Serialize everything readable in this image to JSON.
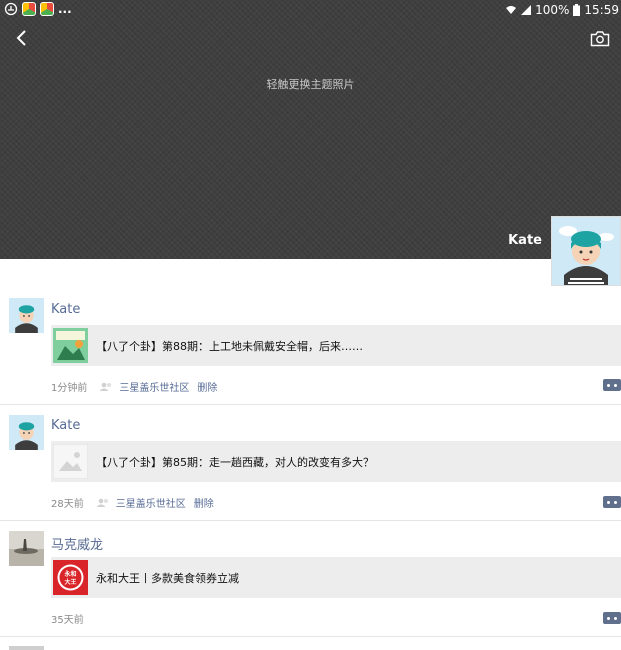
{
  "status_bar": {
    "battery": "100%",
    "time": "15:59",
    "more": "..."
  },
  "cover": {
    "hint": "轻触更换主题照片",
    "user_name": "Kate"
  },
  "posts": [
    {
      "user": "Kate",
      "title": "【八了个卦】第88期：上工地未佩戴安全帽，后来……",
      "time": "1分钟前",
      "place": "三星盖乐世社区",
      "delete": "删除"
    },
    {
      "user": "Kate",
      "title": "【八了个卦】第85期：走一趟西藏，对人的改变有多大？",
      "time": "28天前",
      "place": "三星盖乐世社区",
      "delete": "删除"
    },
    {
      "user": "马克威龙",
      "title": "永和大王丨多款美食领券立减",
      "time": "35天前",
      "thumb_label": "永和大王"
    }
  ]
}
